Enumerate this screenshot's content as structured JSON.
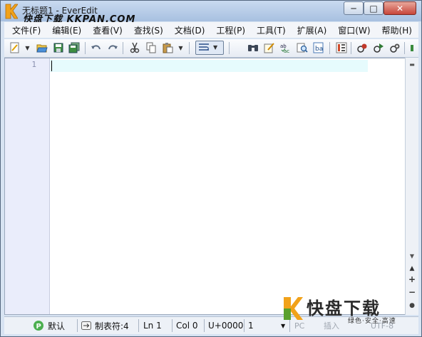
{
  "window": {
    "title": "无标题1 - EverEdit",
    "watermark_top": "快盘下载 KKPAN.COM",
    "minimize_glyph": "─",
    "maximize_glyph": "□",
    "close_glyph": "✕"
  },
  "menu": [
    {
      "label": "文件(F)"
    },
    {
      "label": "编辑(E)"
    },
    {
      "label": "查看(V)"
    },
    {
      "label": "查找(S)"
    },
    {
      "label": "文档(D)"
    },
    {
      "label": "工程(P)"
    },
    {
      "label": "工具(T)"
    },
    {
      "label": "扩展(A)"
    },
    {
      "label": "窗口(W)"
    },
    {
      "label": "帮助(H)"
    }
  ],
  "toolbar": {
    "icons": [
      "new-document-icon",
      "open-folder-icon",
      "save-icon",
      "save-all-icon",
      "undo-icon",
      "redo-icon",
      "cut-icon",
      "copy-icon",
      "paste-icon",
      "word-wrap-icon",
      "find-binoculars-icon",
      "edit-note-icon",
      "spell-check-icon",
      "find-in-files-icon",
      "replace-icon",
      "column-mode-icon",
      "macro-record-icon",
      "macro-play-icon",
      "macro-run-icon"
    ]
  },
  "editor": {
    "line_number": "1",
    "content": ""
  },
  "scrollbar": {
    "plus_glyph": "+",
    "minus_glyph": "−",
    "zoom_reset_glyph": "●"
  },
  "status": {
    "syntax": "默认",
    "tab_mode": "制表符:4",
    "line": "Ln 1",
    "column": "Col 0",
    "codepoint": "U+0000",
    "selection": "1",
    "line_ending": "PC",
    "insert_mode": "插入",
    "encoding": "UTF-8"
  },
  "watermark_bottom": {
    "main": "快盘下载",
    "sub": "绿色·安全·高速"
  }
}
